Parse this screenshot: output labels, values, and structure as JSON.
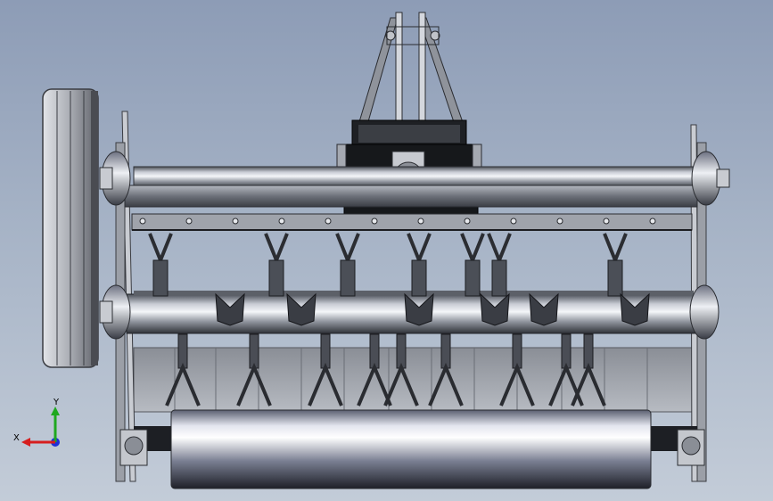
{
  "triad": {
    "x_label": "X",
    "y_label": "Y",
    "x_color": "#d61e1e",
    "y_color": "#1fa81f",
    "z_color": "#1f2fd6"
  },
  "colors": {
    "bg_top": "#8d9cb6",
    "bg_bottom": "#c3ccd8",
    "steel_dark": "#2a2d33",
    "steel_mid": "#7c818b",
    "steel_light": "#d9dde4"
  },
  "view": {
    "model_type": "rotary-tiller-assembly",
    "projection": "front-orthographic"
  }
}
